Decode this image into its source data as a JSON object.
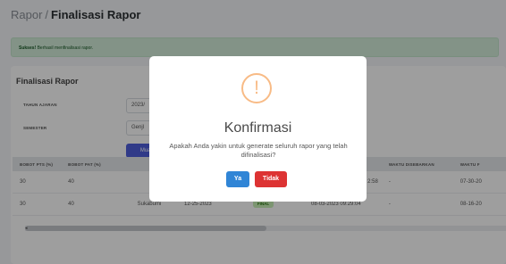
{
  "breadcrumb": {
    "parent": "Rapor",
    "separator": "/",
    "current": "Finalisasi Rapor"
  },
  "alert": {
    "label": "Sukses!",
    "message": "Berhasil menfinalisasi rapor."
  },
  "card": {
    "title": "Finalisasi Rapor",
    "form": {
      "tahun_ajaran_label": "TAHUN AJARAN",
      "tahun_ajaran_value": "2023/",
      "semester_label": "SEMESTER",
      "semester_value": "Genjl",
      "muat_button": "Muat"
    }
  },
  "table": {
    "headers": [
      "BOBOT PTS (%)",
      "BOBOT PAT (%)",
      "",
      "",
      "",
      "T",
      "WAKTU DISEBARKAN",
      "WAKTU F"
    ],
    "rows": [
      {
        "c1": "30",
        "c2": "40",
        "c3": "",
        "c4": "",
        "c5": "",
        "c6": "2:58",
        "c7": "-",
        "c8": "07-30-20"
      },
      {
        "c1": "30",
        "c2": "40",
        "c3": "Sukabumi",
        "c4": "12-25-2023",
        "c5": "FINAL",
        "c6": "08-03-2023 09:29:04",
        "c7": "-",
        "c8": "08-16-20"
      }
    ],
    "scroll_left_glyph": "◂"
  },
  "modal": {
    "icon_glyph": "!",
    "title": "Konfirmasi",
    "text": "Apakah Anda yakin untuk generate seluruh rapor yang telah difinalisasi?",
    "confirm_label": "Ya",
    "cancel_label": "Tidak"
  },
  "colors": {
    "confirm": "#3085d6",
    "cancel": "#dd3333",
    "warning": "#f8bb86",
    "primary": "#4e5edb",
    "success_bg": "#d4edda"
  },
  "icons": {
    "warning": "exclamation-circle-icon"
  }
}
